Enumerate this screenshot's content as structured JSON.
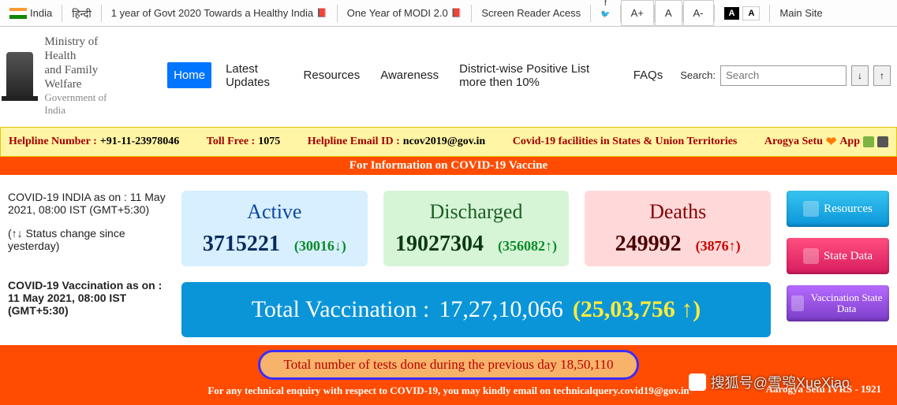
{
  "topbar": {
    "country": "India",
    "lang": "हिन्दी",
    "link1": "1 year of Govt 2020 Towards a Healthy India",
    "link2": "One Year of MODI 2.0",
    "reader": "Screen Reader Acess",
    "aplus": "A+",
    "a": "A",
    "aminus": "A-",
    "scheme_dark": "A",
    "scheme_light": "A",
    "mainsite": "Main Site"
  },
  "ministry": {
    "l1a": "Ministry of Health",
    "l1b": "and Family Welfare",
    "l2": "Government of India"
  },
  "nav": [
    "Home",
    "Latest Updates",
    "Resources",
    "Awareness",
    "District-wise Positive List more then 10%",
    "FAQs"
  ],
  "search": {
    "label": "Search:",
    "placeholder": "Search",
    "up": "↓",
    "down": "↑"
  },
  "helpline": {
    "hnum_label": "Helpline Number :",
    "hnum": "+91-11-23978046",
    "toll_label": "Toll Free :",
    "toll": "1075",
    "email_label": "Helpline Email ID :",
    "email": "ncov2019@gov.in",
    "facilities": "Covid-19 facilities in States & Union Territories",
    "arogya": "Arogya Setu",
    "app": "App"
  },
  "banner": "For Information on COVID-19 Vaccine",
  "status": {
    "as_on": "COVID-19 INDIA as on : 11 May 2021, 08:00 IST (GMT+5:30)",
    "change": "(↑↓ Status change since yesterday)",
    "vac_as_on": "COVID-19 Vaccination as on : 11 May 2021, 08:00 IST (GMT+5:30)"
  },
  "cards": {
    "active": {
      "title": "Active",
      "value": "3715221",
      "delta": "(30016↓)"
    },
    "discharged": {
      "title": "Discharged",
      "value": "19027304",
      "delta": "(356082↑)"
    },
    "deaths": {
      "title": "Deaths",
      "value": "249992",
      "delta": "(3876↑)"
    }
  },
  "vaccination": {
    "label": "Total Vaccination :",
    "value": "17,27,10,066",
    "delta": "(25,03,756 ↑)"
  },
  "rbtns": {
    "resources": "Resources",
    "state": "State Data",
    "vacstate": "Vaccination State Data"
  },
  "bottom": {
    "tests": "Total number of tests done during the previous day 18,50,110",
    "tech": "For any technical enquiry with respect to COVID-19, you may kindly email on technicalquery.covid19@gov.in",
    "ivrs": "Aarogya Setu IVRS - 1921"
  },
  "watermark": "搜狐号@雪鸮XueXiao"
}
